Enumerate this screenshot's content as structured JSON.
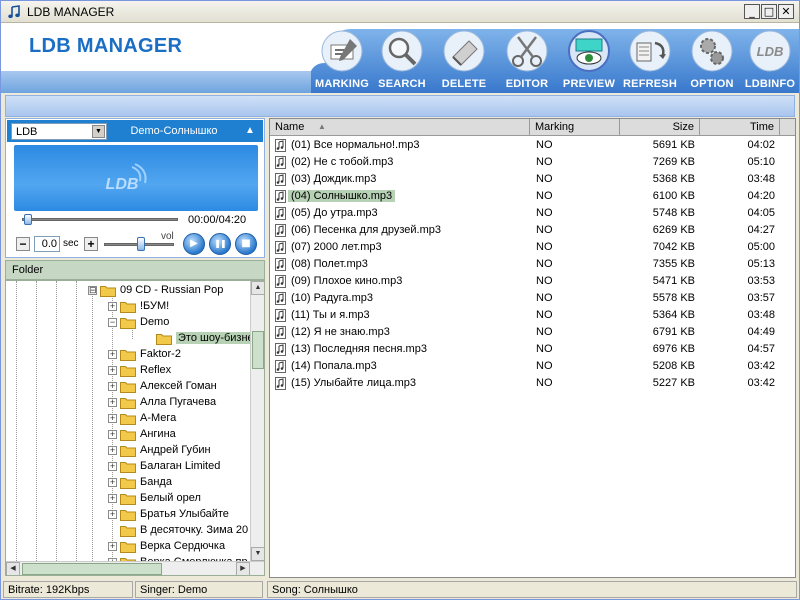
{
  "window": {
    "title": "LDB MANAGER",
    "controls": {
      "minimize": "_",
      "maximize": "□",
      "close": "✕"
    }
  },
  "header": {
    "brand": "LDB MANAGER",
    "toolbar": [
      {
        "id": "marking",
        "label": "MARKING",
        "icon": "marking-icon"
      },
      {
        "id": "search",
        "label": "SEARCH",
        "icon": "magnifier-icon"
      },
      {
        "id": "delete",
        "label": "DELETE",
        "icon": "eraser-icon"
      },
      {
        "id": "editor",
        "label": "EDITOR",
        "icon": "scissors-icon"
      },
      {
        "id": "preview",
        "label": "PREVIEW",
        "icon": "eye-icon"
      },
      {
        "id": "refresh",
        "label": "REFRESH",
        "icon": "refresh-icon"
      },
      {
        "id": "option",
        "label": "OPTION",
        "icon": "gears-icon"
      },
      {
        "id": "ldbinfo",
        "label": "LDBINFO",
        "icon": "ldb-logo-icon"
      }
    ]
  },
  "player": {
    "source_select": "LDB",
    "current_song": "Demo-Солнышко",
    "screen_logo": "LDB",
    "time": "00:00/04:20",
    "seek_fraction": 0.0,
    "offset_value": "0.0",
    "offset_unit": "sec",
    "volume_label": "vol",
    "volume_fraction": 0.5,
    "buttons": {
      "play": "▶",
      "pause": "❚❚",
      "stop": "■"
    }
  },
  "folder_panel": {
    "header": "Folder",
    "items": [
      {
        "label": "09 CD - Russian Pop",
        "level": 0,
        "expander": "⊟"
      },
      {
        "label": "!БУМ!",
        "level": 1,
        "expander": "+"
      },
      {
        "label": "Demo",
        "level": 1,
        "expander": "−"
      },
      {
        "label": "Это шоу-бизнес, Е",
        "level": 2,
        "expander": "",
        "selected": true
      },
      {
        "label": "Faktor-2",
        "level": 1,
        "expander": "+"
      },
      {
        "label": "Reflex",
        "level": 1,
        "expander": "+"
      },
      {
        "label": "Алексей Гоман",
        "level": 1,
        "expander": "+"
      },
      {
        "label": "Алла Пугачева",
        "level": 1,
        "expander": "+"
      },
      {
        "label": "А-Мега",
        "level": 1,
        "expander": "+"
      },
      {
        "label": "Ангина",
        "level": 1,
        "expander": "+"
      },
      {
        "label": "Андрей Губин",
        "level": 1,
        "expander": "+"
      },
      {
        "label": "Балаган Limited",
        "level": 1,
        "expander": "+"
      },
      {
        "label": "Банда",
        "level": 1,
        "expander": "+"
      },
      {
        "label": "Белый орел",
        "level": 1,
        "expander": "+"
      },
      {
        "label": "Братья Улыбайте",
        "level": 1,
        "expander": "+"
      },
      {
        "label": "В десяточку. Зима 20",
        "level": 1,
        "expander": ""
      },
      {
        "label": "Верка Сердючка",
        "level": 1,
        "expander": "+"
      },
      {
        "label": "Верка Смерлючка пр",
        "level": 1,
        "expander": "+"
      }
    ]
  },
  "file_list": {
    "columns": [
      "Name",
      "Marking",
      "Size",
      "Time"
    ],
    "rows": [
      {
        "name": "(01) Все нормально!.mp3",
        "marking": "NO",
        "size": "5691 KB",
        "time": "04:02"
      },
      {
        "name": "(02) Не с тобой.mp3",
        "marking": "NO",
        "size": "7269 KB",
        "time": "05:10"
      },
      {
        "name": "(03) Дождик.mp3",
        "marking": "NO",
        "size": "5368 KB",
        "time": "03:48"
      },
      {
        "name": "(04) Солнышко.mp3",
        "marking": "NO",
        "size": "6100 KB",
        "time": "04:20",
        "selected": true
      },
      {
        "name": "(05) До утра.mp3",
        "marking": "NO",
        "size": "5748 KB",
        "time": "04:05"
      },
      {
        "name": "(06) Песенка для друзей.mp3",
        "marking": "NO",
        "size": "6269 KB",
        "time": "04:27"
      },
      {
        "name": "(07) 2000 лет.mp3",
        "marking": "NO",
        "size": "7042 KB",
        "time": "05:00"
      },
      {
        "name": "(08) Полет.mp3",
        "marking": "NO",
        "size": "7355 KB",
        "time": "05:13"
      },
      {
        "name": "(09) Плохое кино.mp3",
        "marking": "NO",
        "size": "5471 KB",
        "time": "03:53"
      },
      {
        "name": "(10) Радуга.mp3",
        "marking": "NO",
        "size": "5578 KB",
        "time": "03:57"
      },
      {
        "name": "(11) Ты и я.mp3",
        "marking": "NO",
        "size": "5364 KB",
        "time": "03:48"
      },
      {
        "name": "(12) Я не знаю.mp3",
        "marking": "NO",
        "size": "6791 KB",
        "time": "04:49"
      },
      {
        "name": "(13) Последняя песня.mp3",
        "marking": "NO",
        "size": "6976 KB",
        "time": "04:57"
      },
      {
        "name": "(14) Попала.mp3",
        "marking": "NO",
        "size": "5208 KB",
        "time": "03:42"
      },
      {
        "name": "(15) Улыбайте лица.mp3",
        "marking": "NO",
        "size": "5227 KB",
        "time": "03:42"
      }
    ]
  },
  "status_bar": {
    "bitrate": "Bitrate: 192Kbps",
    "singer": "Singer: Demo",
    "song": "Song: Солнышко"
  },
  "colors": {
    "brand": "#1a6fc4",
    "toolbar_blue": "#3a7fd2",
    "selection_green": "#b6d1b4",
    "folder_yellow": "#f3c94a"
  }
}
